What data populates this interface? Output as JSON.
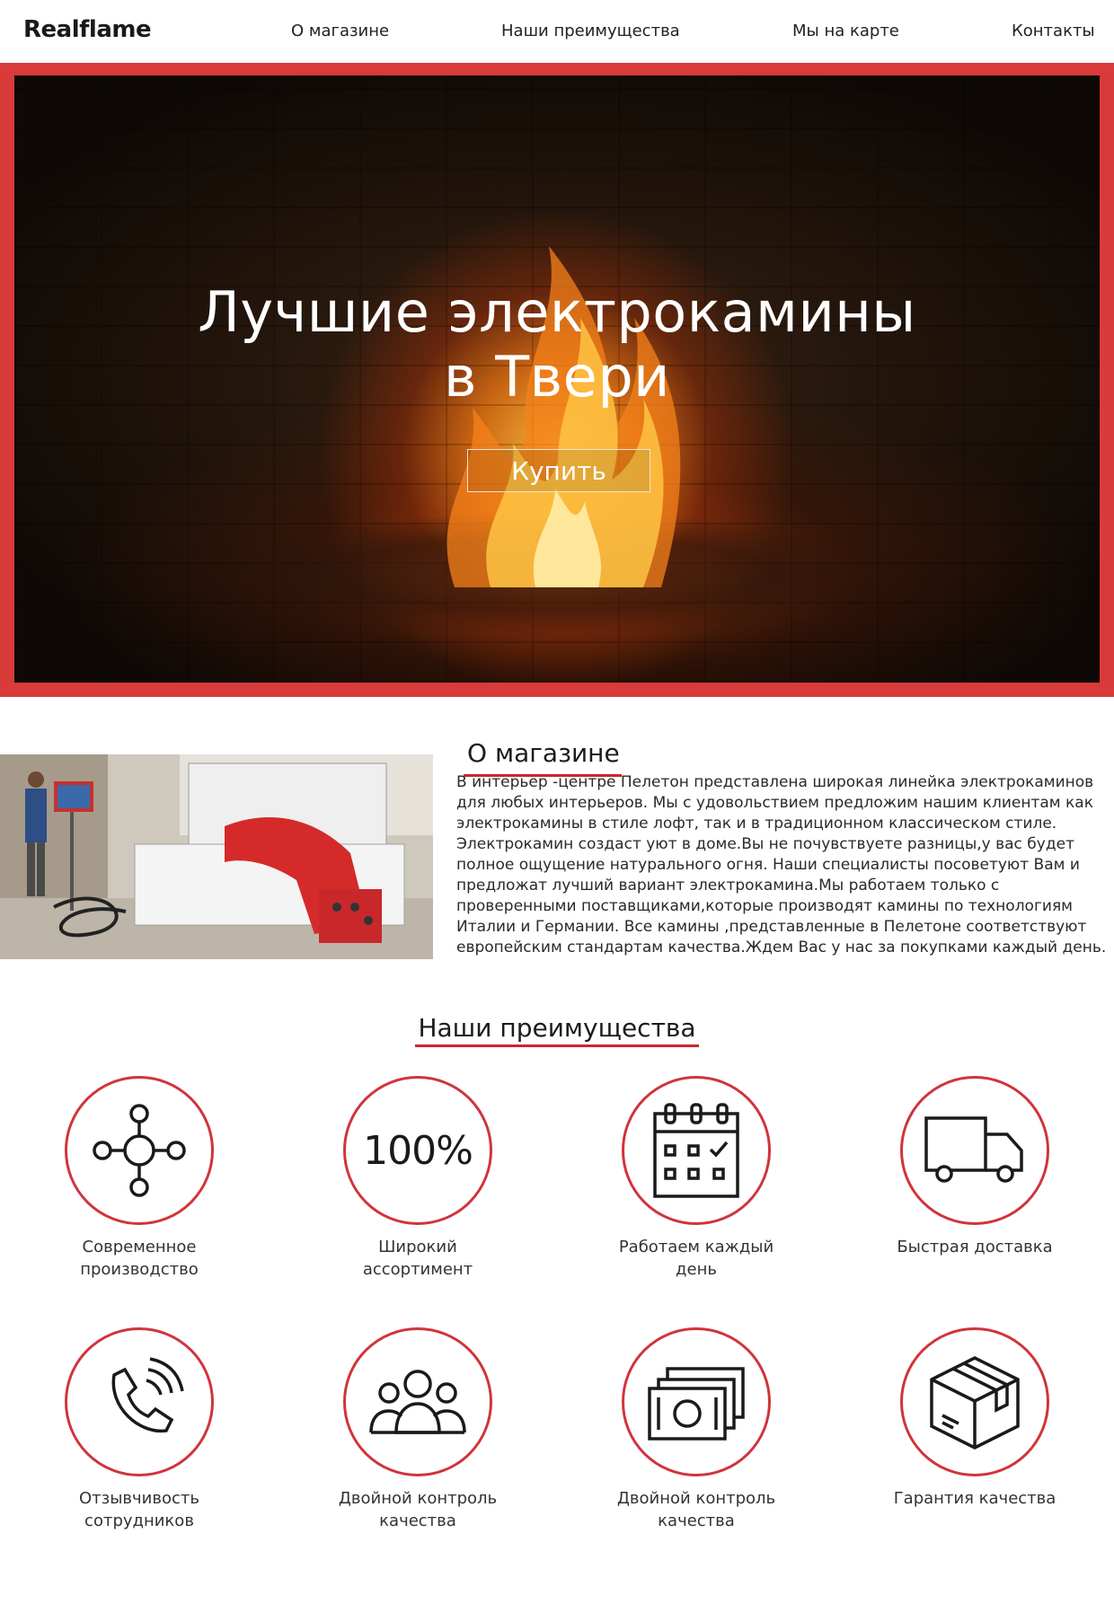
{
  "header": {
    "logo": "Realflame",
    "nav": [
      "О магазине",
      "Наши преимущества",
      "Мы на карте",
      "Контакты"
    ]
  },
  "hero": {
    "title_line1": "Лучшие электрокамины",
    "title_line2": "в Твери",
    "buy_label": "Купить"
  },
  "about": {
    "title": "О магазине",
    "text": "В интерьер -центре Пелетон представлена широкая линейка электрокаминов для любых интерьеров. Мы с удовольствием предложим нашим клиентам как электрокамины в стиле лофт, так и в традиционном классическом стиле. Электрокамин создаст уют в доме.Вы не почувствуете разницы,у вас будет полное ощущение натурального огня. Наши специалисты посоветуют Вам и предложат лучший вариант электрокамина.Мы работаем только с проверенными поставщиками,которые производят камины по технологиям Италии и Германии. Все камины ,представленные в Пелетоне соответствуют европейским стандартам качества.Ждем Вас у нас за покупками каждый день."
  },
  "advantages": {
    "title": "Наши преимущества",
    "items": [
      {
        "icon": "network-icon",
        "label_1": "Современное",
        "label_2": "производство"
      },
      {
        "icon": "percent-icon",
        "icon_text": "100%",
        "label_1": "Широкий",
        "label_2": "ассортимент"
      },
      {
        "icon": "calendar-icon",
        "label_1": "Работаем каждый",
        "label_2": "день"
      },
      {
        "icon": "truck-icon",
        "label_1": "Быстрая доставка",
        "label_2": ""
      },
      {
        "icon": "phone-icon",
        "label_1": "Отзывчивость",
        "label_2": "сотрудников"
      },
      {
        "icon": "people-icon",
        "label_1": "Двойной контроль",
        "label_2": "качества"
      },
      {
        "icon": "money-icon",
        "label_1": "Двойной контроль",
        "label_2": "качества"
      },
      {
        "icon": "box-icon",
        "label_1": "Гарантия качества",
        "label_2": ""
      }
    ]
  },
  "colors": {
    "accent": "#d93a3a",
    "underline": "#c9282d"
  }
}
